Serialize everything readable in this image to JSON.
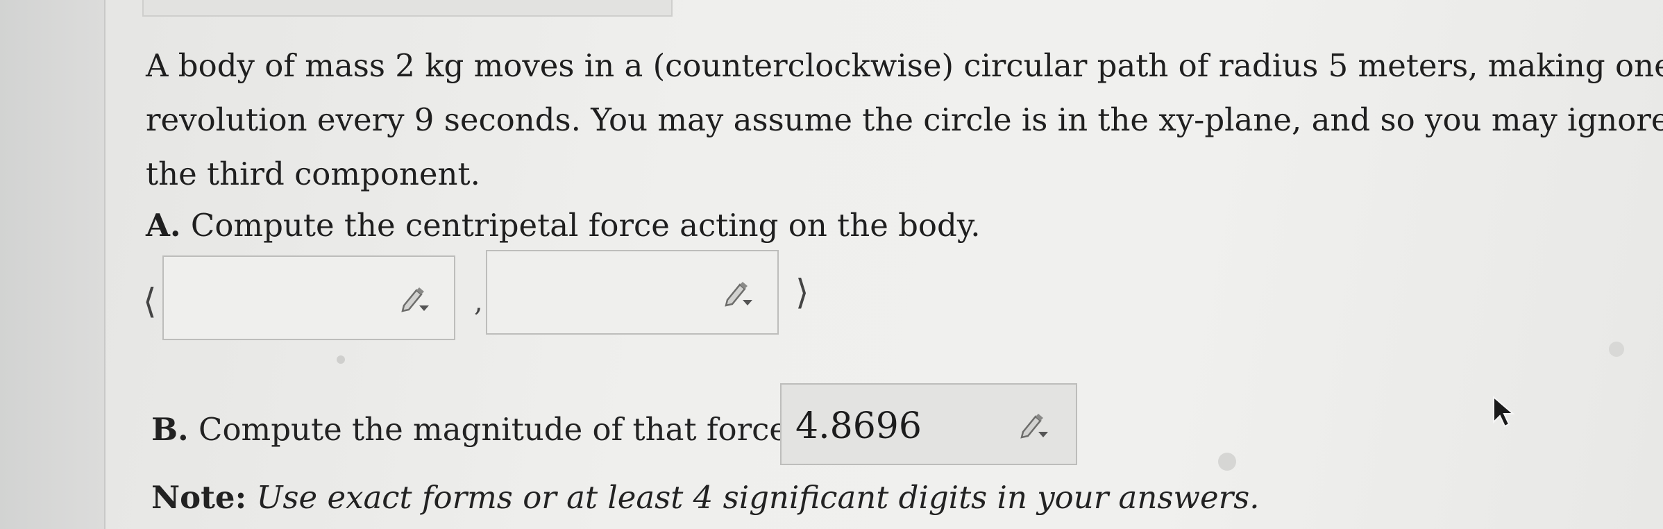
{
  "problem": {
    "line1": "A body of mass 2 kg moves in a (counterclockwise) circular path of radius 5 meters, making one",
    "line2": "revolution every 9 seconds. You may assume the circle is in the xy-plane, and so you may ignore",
    "line3": "the third component."
  },
  "part_a": {
    "label": "A.",
    "text": "Compute the centripetal force acting on the body.",
    "open_bracket": "⟨",
    "separator": ",",
    "close_bracket": "⟩",
    "input1_value": "",
    "input2_value": ""
  },
  "part_b": {
    "label": "B.",
    "text": "Compute the magnitude of that force.",
    "input_value": "4.8696"
  },
  "note": {
    "label": "Note:",
    "text": "Use exact forms or at least 4 significant digits in your answers."
  },
  "icons": {
    "edit": "pencil-dropdown-icon",
    "cursor": "mouse-pointer-icon"
  }
}
